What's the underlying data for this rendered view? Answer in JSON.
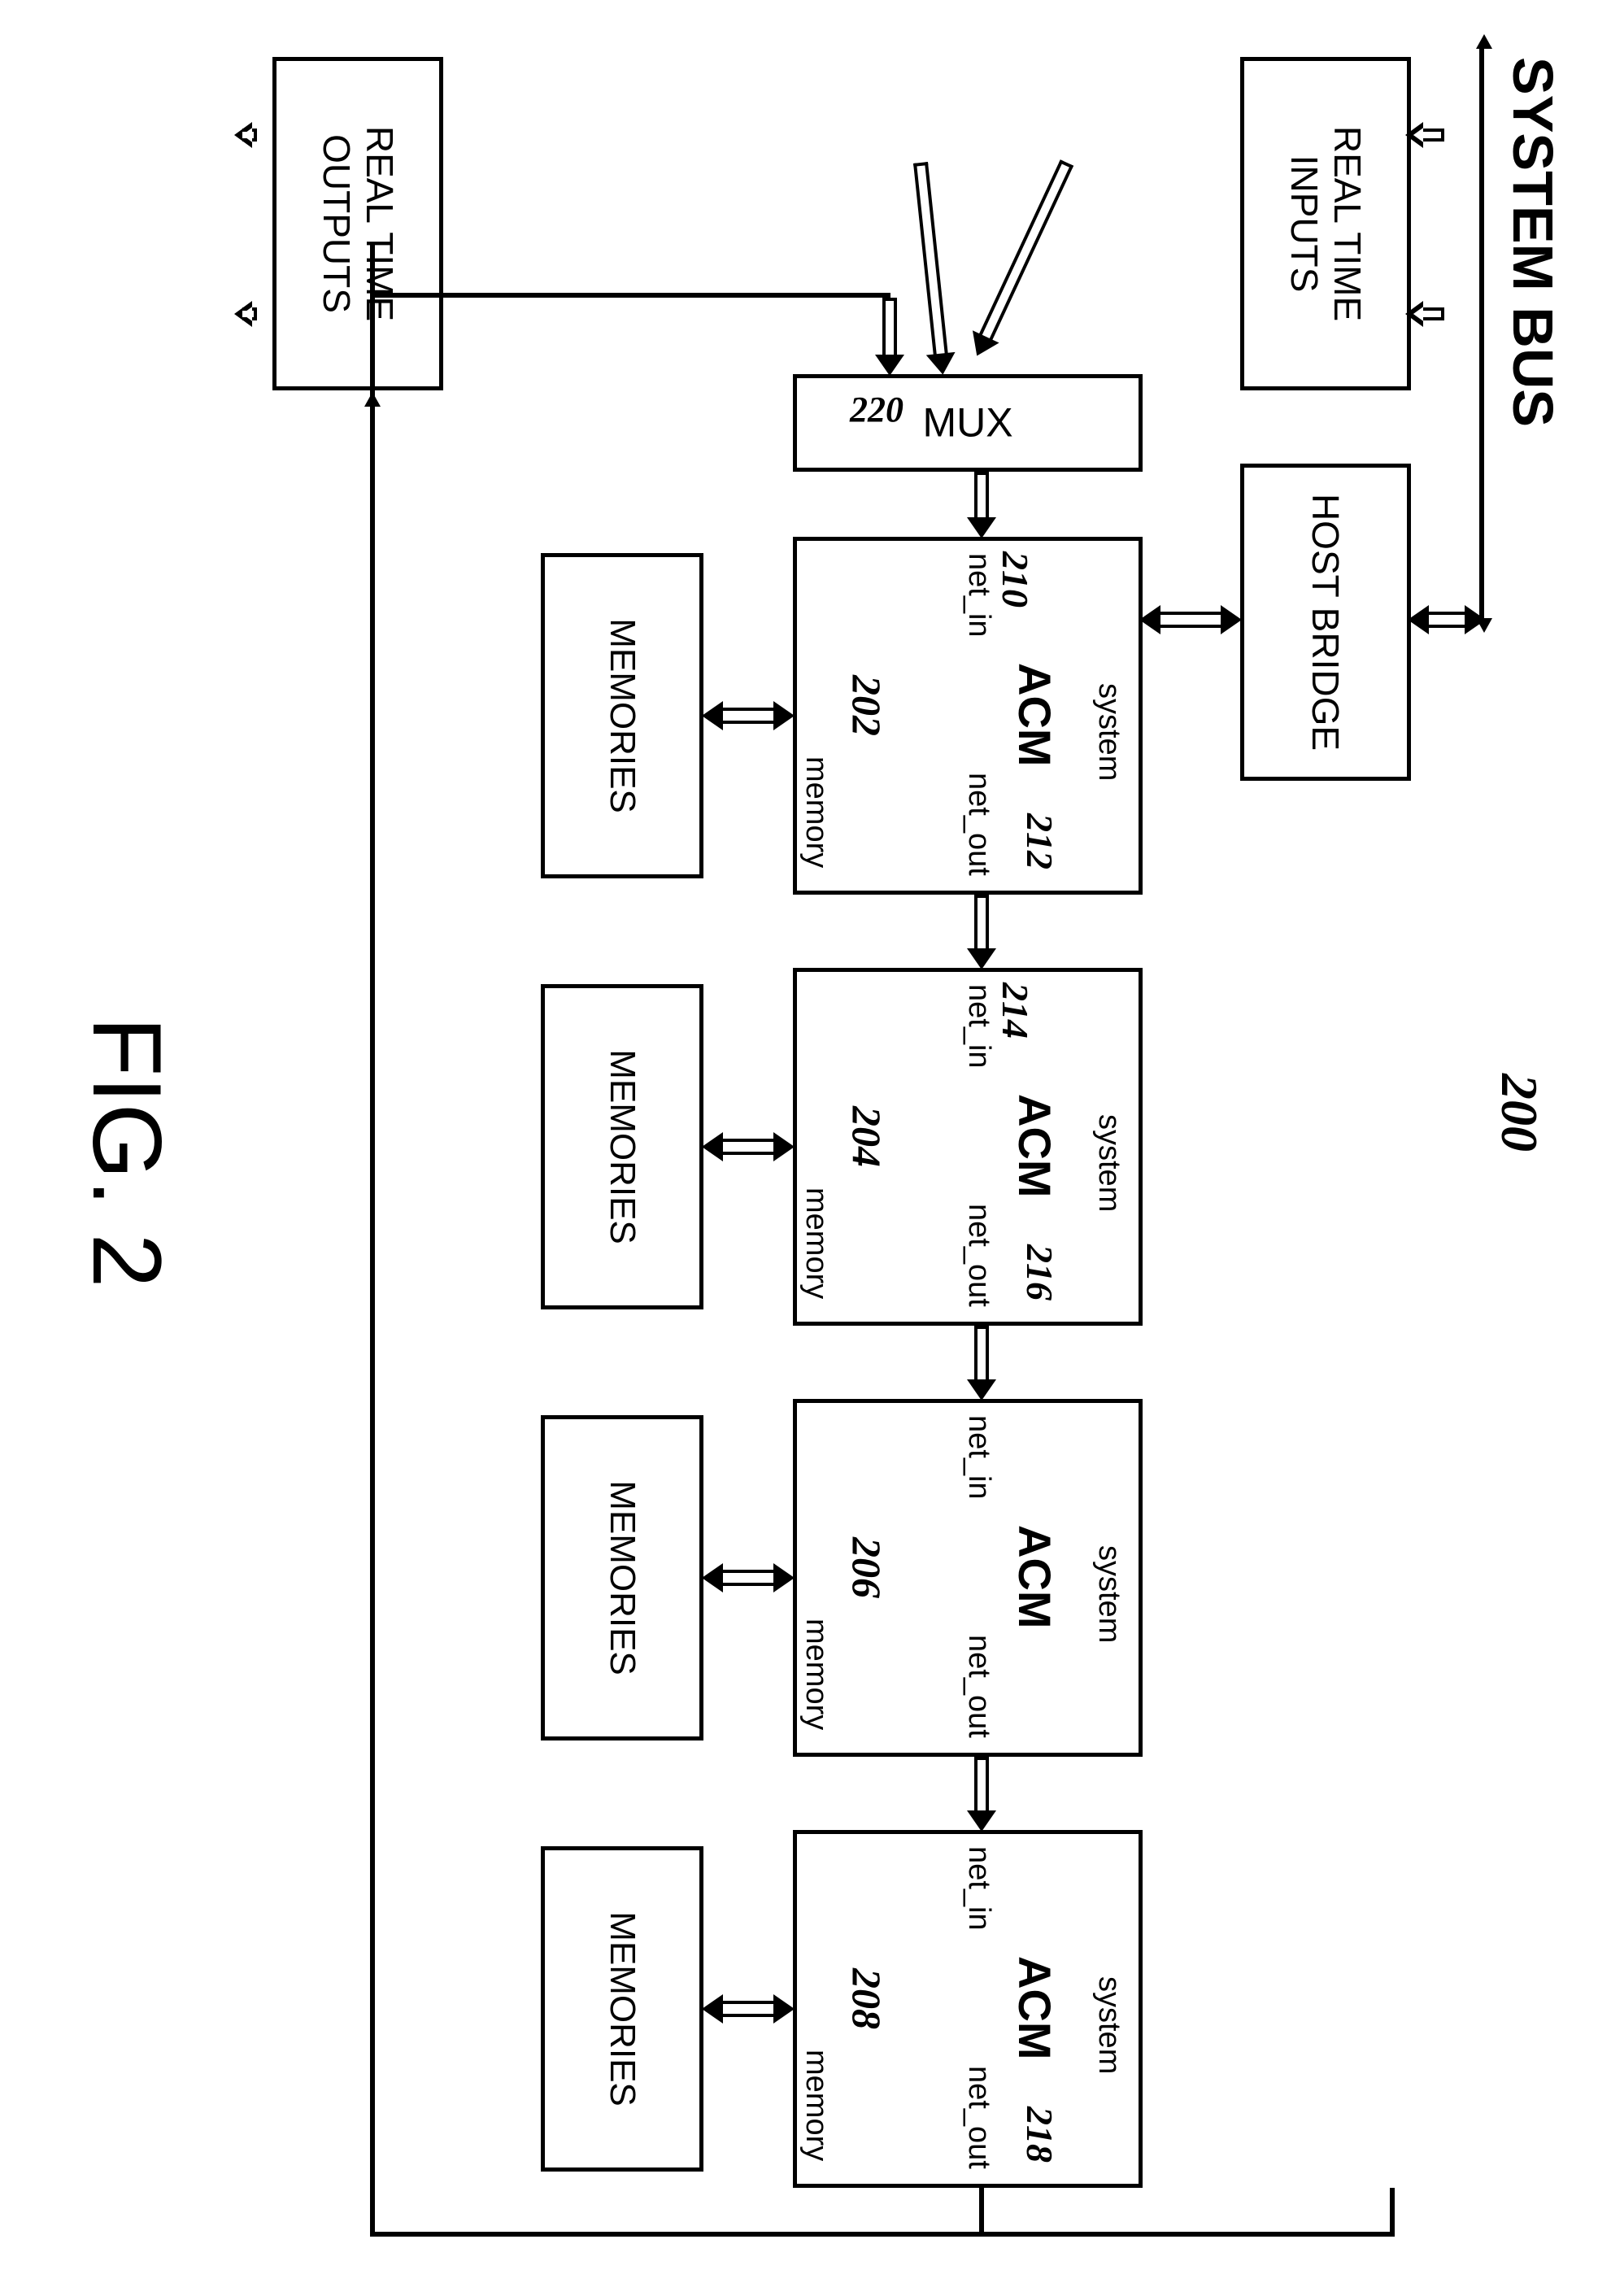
{
  "figure_number_ref": "200",
  "top_bus_label": "SYSTEM BUS",
  "blocks": {
    "real_time_inputs": "REAL TIME\nINPUTS",
    "host_bridge": "HOST BRIDGE",
    "mux": "MUX",
    "mux_ref": "220",
    "real_time_outputs": "REAL TIME\nOUTPUTS",
    "memories": "MEMORIES"
  },
  "acm_common": {
    "title": "ACM",
    "port_system": "system",
    "port_net_in": "net_in",
    "port_net_out": "net_out",
    "port_memory": "memory"
  },
  "acm": [
    {
      "module_ref": "202",
      "net_in_ref": "210",
      "net_out_ref": "212"
    },
    {
      "module_ref": "204",
      "net_in_ref": "214",
      "net_out_ref": "216"
    },
    {
      "module_ref": "206",
      "net_in_ref": "",
      "net_out_ref": ""
    },
    {
      "module_ref": "208",
      "net_in_ref": "",
      "net_out_ref": "218"
    }
  ],
  "caption": "FIG. 2"
}
